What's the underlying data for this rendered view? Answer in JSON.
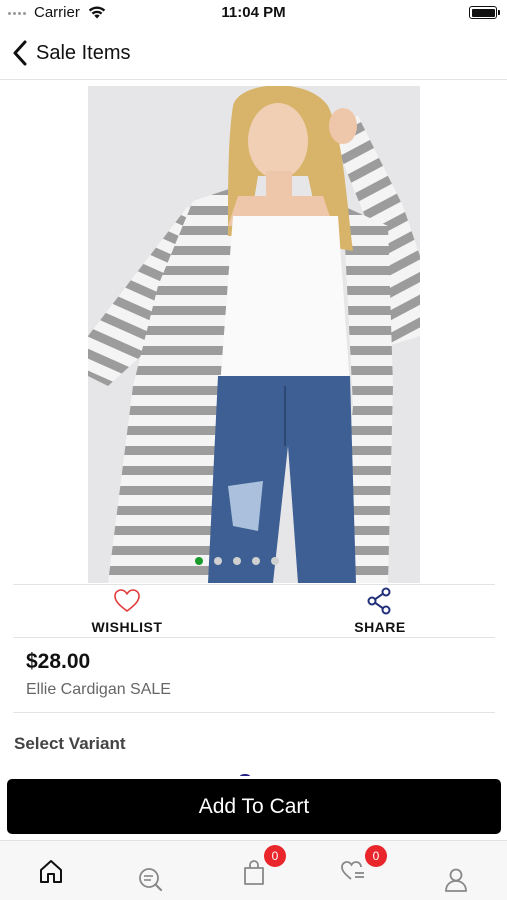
{
  "status_bar": {
    "carrier": "Carrier",
    "time": "11:04 PM"
  },
  "nav": {
    "title": "Sale Items",
    "back_icon": "chevron-left-icon"
  },
  "product": {
    "image_icon": "product-photo",
    "carousel": {
      "count": 5,
      "active_index": 0,
      "active_color": "#1a9a2a"
    },
    "price": "$28.00",
    "name": "Ellie Cardigan SALE"
  },
  "actions": {
    "wishlist": {
      "label": "WISHLIST",
      "icon": "heart-icon",
      "color": "#e23b3b"
    },
    "share": {
      "label": "SHARE",
      "icon": "share-icon",
      "color": "#22307a"
    }
  },
  "variant": {
    "title": "Select Variant"
  },
  "cart_button": {
    "label": "Add To Cart"
  },
  "tab_bar": {
    "tabs": [
      {
        "icon": "home-icon"
      },
      {
        "icon": "search-list-icon"
      },
      {
        "icon": "shopping-bag-icon",
        "badge": "0"
      },
      {
        "icon": "wishlist-list-icon",
        "badge": "0"
      },
      {
        "icon": "user-icon"
      }
    ],
    "badge_color": "#e8262b"
  }
}
